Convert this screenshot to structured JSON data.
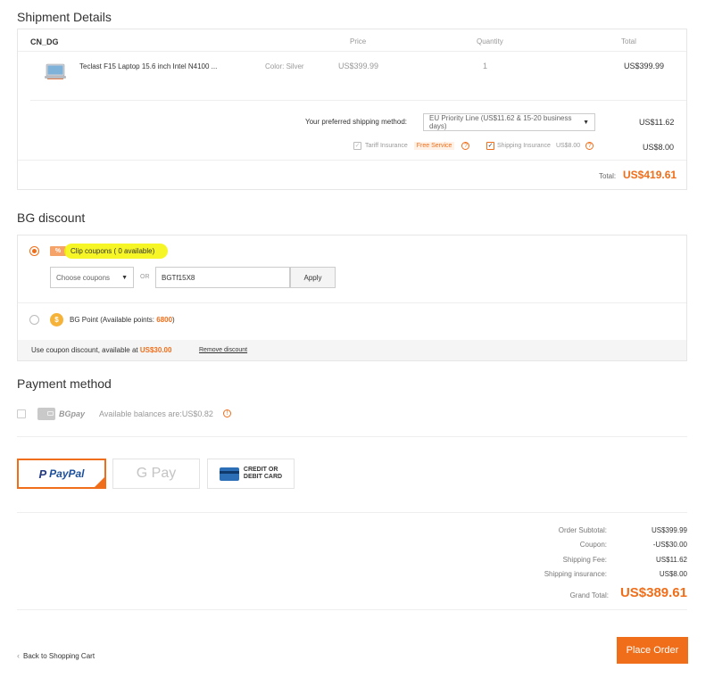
{
  "shipment": {
    "title": "Shipment Details",
    "store": "CN_DG",
    "headers": {
      "price": "Price",
      "quantity": "Quantity",
      "total": "Total"
    },
    "item": {
      "name": "Teclast F15 Laptop 15.6 inch Intel N4100 ...",
      "color": "Color: Silver",
      "price": "US$399.99",
      "quantity": "1",
      "total": "US$399.99"
    },
    "shipping_method_label": "Your preferred shipping method:",
    "shipping_method_value": "EU Priority Line (US$11.62 & 15-20 business days)",
    "shipping_cost": "US$11.62",
    "tariff_label": "Tariff Insurance",
    "free_service": "Free Service",
    "shipping_insurance_label": "Shipping Insurance",
    "shipping_insurance_price": "US$8.00",
    "insurance_total": "US$8.00",
    "total_label": "Total:",
    "total_value": "US$419.61"
  },
  "discount": {
    "title": "BG discount",
    "clip_coupons": "Clip coupons ( 0 available)",
    "coupon_tag": "%",
    "choose_coupons": "Choose coupons",
    "or": "OR",
    "coupon_code": "BGTf15X8",
    "apply": "Apply",
    "bg_point_prefix": "BG Point (Available points: ",
    "bg_point_value": "6800",
    "bg_point_suffix": ")",
    "notice_prefix": "Use coupon discount, available at ",
    "notice_value": "US$30.00",
    "remove": "Remove discount"
  },
  "payment": {
    "title": "Payment method",
    "bgpay": "BGpay",
    "balance": "Available balances are:US$0.82",
    "paypal": "PayPal",
    "gpay": "G Pay",
    "card_line1": "CREDIT OR",
    "card_line2": "DEBIT CARD"
  },
  "summary": {
    "subtotal_label": "Order Subtotal:",
    "subtotal_value": "US$399.99",
    "coupon_label": "Coupon:",
    "coupon_value": "-US$30.00",
    "shipping_label": "Shipping Fee:",
    "shipping_value": "US$11.62",
    "insurance_label": "Shipping insurance:",
    "insurance_value": "US$8.00",
    "grand_label": "Grand Total:",
    "grand_value": "US$389.61"
  },
  "footer": {
    "back": "Back to Shopping Cart",
    "place_order": "Place Order"
  },
  "colors": {
    "accent": "#f06e1a",
    "highlight": "#f5f500"
  }
}
